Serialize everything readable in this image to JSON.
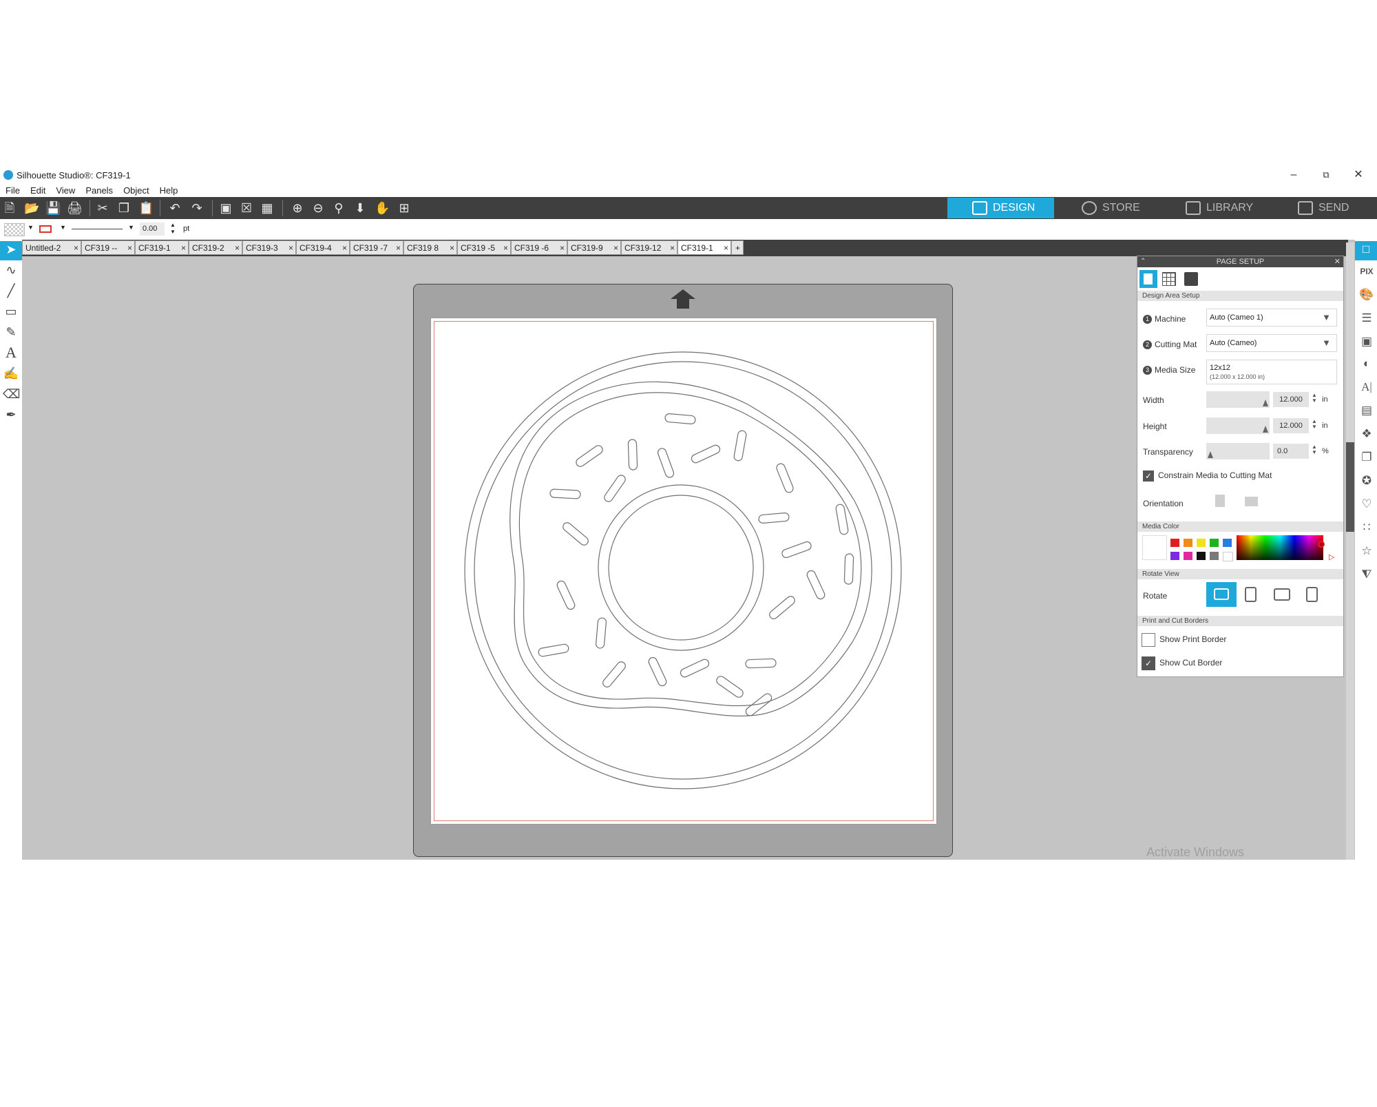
{
  "window": {
    "title": "Silhouette Studio®: CF319-1"
  },
  "menu": [
    "File",
    "Edit",
    "View",
    "Panels",
    "Object",
    "Help"
  ],
  "nav_tabs": [
    {
      "label": "DESIGN",
      "active": true
    },
    {
      "label": "STORE",
      "active": false
    },
    {
      "label": "LIBRARY",
      "active": false
    },
    {
      "label": "SEND",
      "active": false
    }
  ],
  "line_options": {
    "line_width": "0.00",
    "unit": "pt"
  },
  "doc_tabs": [
    "Untitled-2",
    "CF319 --",
    "CF319-1",
    "CF319-2",
    "CF319-3",
    "CF319-4",
    "CF319 -7",
    "CF319 8",
    "CF319 -5",
    "CF319 -6",
    "CF319-9",
    "CF319-12",
    "CF319-1"
  ],
  "active_doc_tab_index": 12,
  "page_setup": {
    "title": "PAGE SETUP",
    "section_design_area": "Design Area Setup",
    "machine_label": "Machine",
    "machine_value": "Auto (Cameo 1)",
    "cutting_mat_label": "Cutting Mat",
    "cutting_mat_value": "Auto (Cameo)",
    "media_size_label": "Media Size",
    "media_size_value": "12x12",
    "media_size_sub": "(12.000 x 12.000 in)",
    "width_label": "Width",
    "width_value": "12.000",
    "width_unit": "in",
    "height_label": "Height",
    "height_value": "12.000",
    "height_unit": "in",
    "transparency_label": "Transparency",
    "transparency_value": "0.0",
    "transparency_unit": "%",
    "constrain_label": "Constrain Media to Cutting Mat",
    "constrain_checked": true,
    "orientation_label": "Orientation",
    "section_media_color": "Media Color",
    "swatch_colors": [
      "#e02020",
      "#f08a1a",
      "#f2e21a",
      "#1fb31f",
      "#2a7de0",
      "#7a2ae0",
      "#e02aa0",
      "#111111",
      "#7a7a7a",
      "#ffffff"
    ],
    "section_rotate_view": "Rotate View",
    "rotate_label": "Rotate",
    "section_borders": "Print and Cut Borders",
    "show_print_border_label": "Show Print Border",
    "show_print_border_checked": false,
    "show_cut_border_label": "Show Cut Border",
    "show_cut_border_checked": true
  },
  "accent_color": "#1fa9db",
  "watermark": "Activate Windows"
}
